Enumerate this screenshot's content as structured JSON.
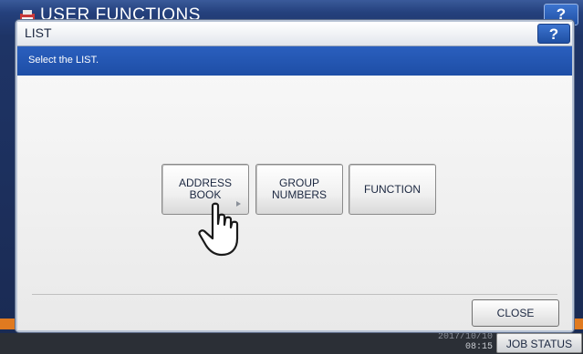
{
  "background": {
    "title": "USER FUNCTIONS",
    "help_label": "?",
    "clock_date": "2017/10/10",
    "clock_time": "08:15",
    "job_status_label": "JOB STATUS"
  },
  "dialog": {
    "title": "LIST",
    "help_label": "?",
    "message": "Select the LIST.",
    "buttons": {
      "address_book": "ADDRESS\nBOOK",
      "group_numbers": "GROUP\nNUMBERS",
      "function": "FUNCTION"
    },
    "close_label": "CLOSE"
  },
  "colors": {
    "accent_blue": "#1e4ea6",
    "help_blue": "#2e63c2",
    "orange": "#e07a20"
  },
  "icons": [
    "printer-icon",
    "pointing-hand-icon",
    "submenu-arrow-icon"
  ]
}
